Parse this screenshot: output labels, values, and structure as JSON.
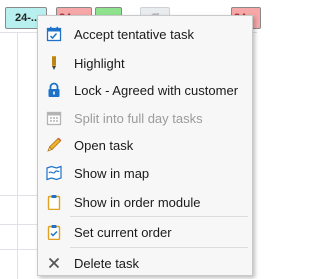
{
  "schedule": {
    "task_chip_label": "24-..",
    "task_chip_partial_1": "24",
    "task_chip_partial_2": "24"
  },
  "context_menu": {
    "items": [
      {
        "label": "Accept tentative task",
        "icon": "calendar-accept-icon",
        "enabled": true
      },
      {
        "label": "Highlight",
        "icon": "highlighter-icon",
        "enabled": true
      },
      {
        "label": "Lock - Agreed with customer",
        "icon": "lock-icon",
        "enabled": true
      },
      {
        "label": "Split into full day tasks",
        "icon": "split-calendar-icon",
        "enabled": false
      },
      {
        "label": "Open task",
        "icon": "pencil-icon",
        "enabled": true
      },
      {
        "label": "Show in map",
        "icon": "map-icon",
        "enabled": true
      },
      {
        "label": "Show in order module",
        "icon": "clipboard-icon",
        "enabled": true
      },
      {
        "label": "Set current order",
        "icon": "clipboard-check-icon",
        "enabled": true
      },
      {
        "label": "Delete task",
        "icon": "close-icon",
        "enabled": true
      }
    ]
  },
  "colors": {
    "menu_background": "#f7f7f7",
    "disabled_text": "#9b9b9b",
    "icon_blue": "#1e73c8",
    "icon_orange": "#e0a020"
  }
}
